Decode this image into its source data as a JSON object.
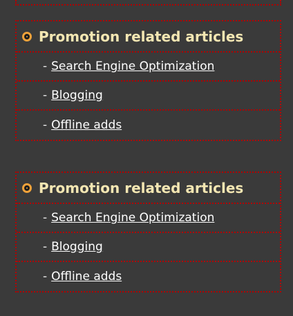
{
  "sections": [
    {
      "title": "Promotion related articles",
      "items": [
        {
          "prefix": "-",
          "label": "Search Engine Optimization"
        },
        {
          "prefix": "-",
          "label": "Blogging"
        },
        {
          "prefix": "-",
          "label": "Offline adds"
        }
      ]
    },
    {
      "title": "Promotion related articles",
      "items": [
        {
          "prefix": "-",
          "label": "Search Engine Optimization"
        },
        {
          "prefix": "-",
          "label": "Blogging"
        },
        {
          "prefix": "-",
          "label": "Offline adds"
        }
      ]
    }
  ],
  "colors": {
    "background": "#3a3a3a",
    "border": "#b40000",
    "title": "#f3e6b2",
    "bullet_ring": "#f0a23a",
    "link": "#ffffff"
  },
  "icons": {
    "section_bullet": "circle-bullet-icon"
  }
}
